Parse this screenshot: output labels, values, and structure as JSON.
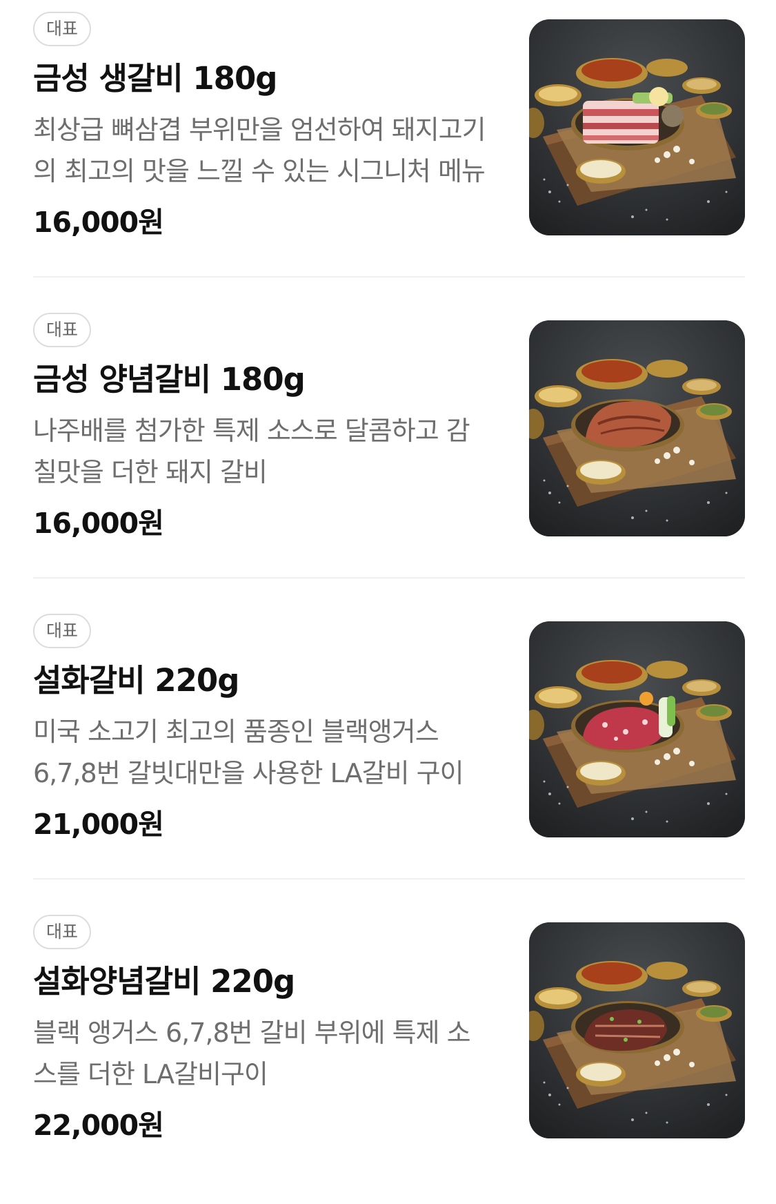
{
  "menu": {
    "items": [
      {
        "badge": "대표",
        "name": "금성 생갈비 180g",
        "description": "최상급 뼈삼겹 부위만을 엄선하여 돼지고기의 최고의 맛을 느낄 수 있는 시그니처 메뉴",
        "price": "16,000원",
        "meat": "raw-pork-slab"
      },
      {
        "badge": "대표",
        "name": "금성 양념갈비 180g",
        "description": "나주배를 첨가한 특제 소스로 달콤하고 감칠맛을 더한 돼지 갈비",
        "price": "16,000원",
        "meat": "marinated-pork"
      },
      {
        "badge": "대표",
        "name": "설화갈비 220g",
        "description": "미국 소고기 최고의 품종인 블랙앵거스 6,7,8번 갈빗대만을 사용한 LA갈비 구이",
        "price": "21,000원",
        "meat": "raw-beef-ribs"
      },
      {
        "badge": "대표",
        "name": "설화양념갈비 220g",
        "description": "블랙 앵거스 6,7,8번 갈비 부위에 특제 소스를 더한 LA갈비구이",
        "price": "22,000원",
        "meat": "marinated-beef-ribs"
      }
    ]
  }
}
